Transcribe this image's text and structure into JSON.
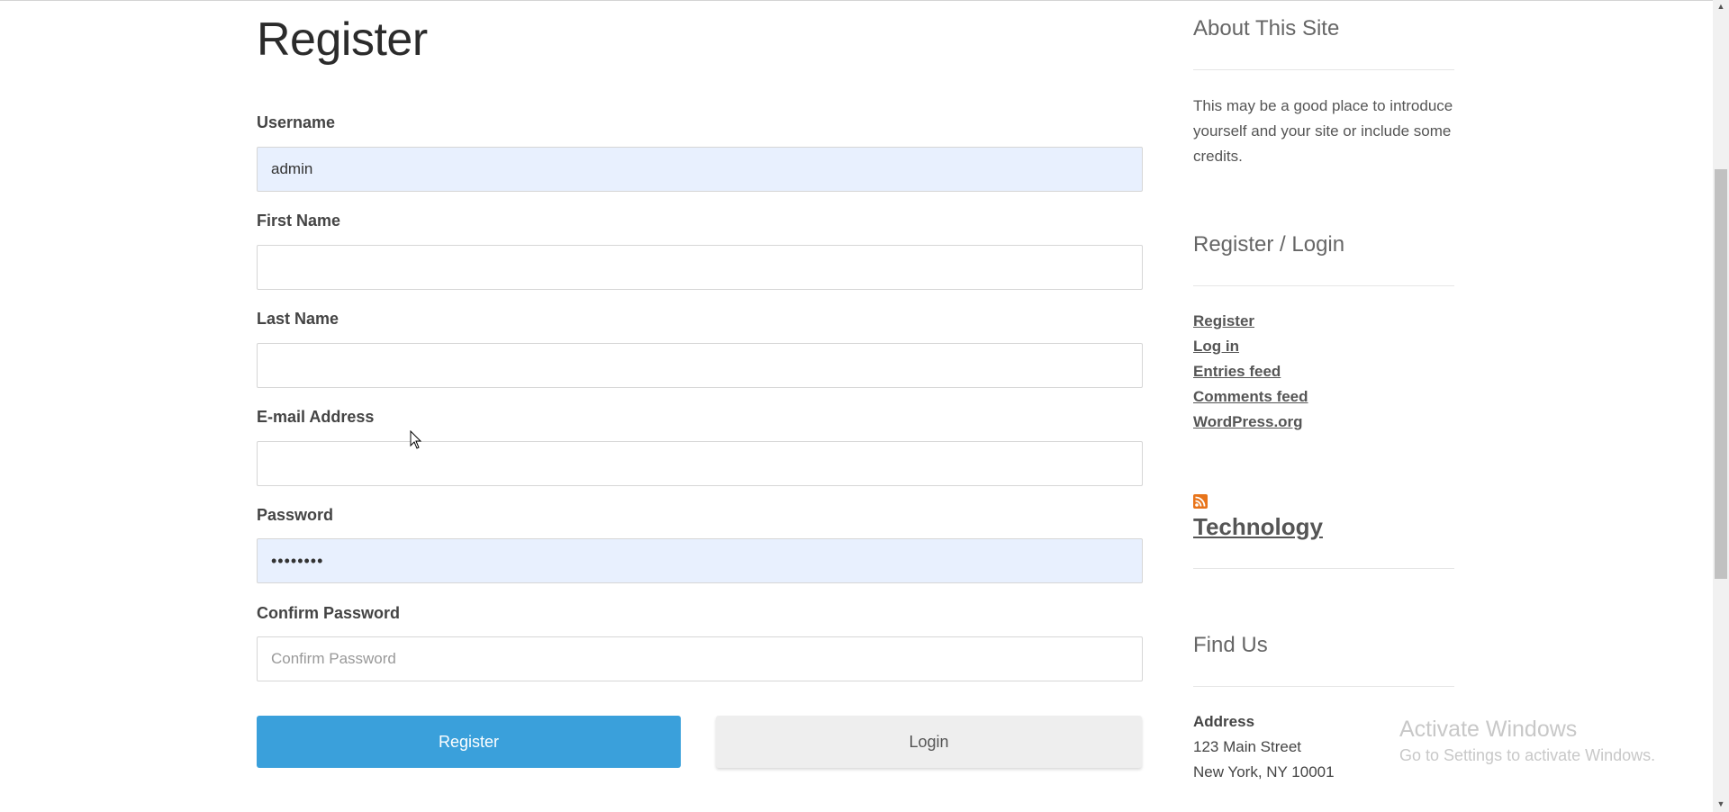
{
  "form": {
    "title": "Register",
    "fields": {
      "username": {
        "label": "Username",
        "value": "admin"
      },
      "first_name": {
        "label": "First Name",
        "value": ""
      },
      "last_name": {
        "label": "Last Name",
        "value": ""
      },
      "email": {
        "label": "E-mail Address",
        "value": ""
      },
      "password": {
        "label": "Password",
        "value": "••••••••"
      },
      "confirm_password": {
        "label": "Confirm Password",
        "placeholder": "Confirm Password"
      }
    },
    "register_button": "Register",
    "login_button": "Login"
  },
  "sidebar": {
    "about": {
      "title": "About This Site",
      "text": "This may be a good place to introduce yourself and your site or include some credits."
    },
    "register_login": {
      "title": "Register / Login",
      "links": [
        "Register",
        "Log in",
        "Entries feed",
        "Comments feed",
        "WordPress.org"
      ]
    },
    "rss": {
      "icon": "rss-icon",
      "title": "Technology"
    },
    "find_us": {
      "title": "Find Us",
      "address_label": "Address",
      "address_line1": "123 Main Street",
      "address_line2": "New York, NY 10001"
    }
  },
  "watermark": {
    "title": "Activate Windows",
    "subtitle": "Go to Settings to activate Windows."
  },
  "colors": {
    "primary_button": "#3aa0db",
    "autofill_bg": "#e8f0fe",
    "rss_orange": "#e8741a"
  }
}
